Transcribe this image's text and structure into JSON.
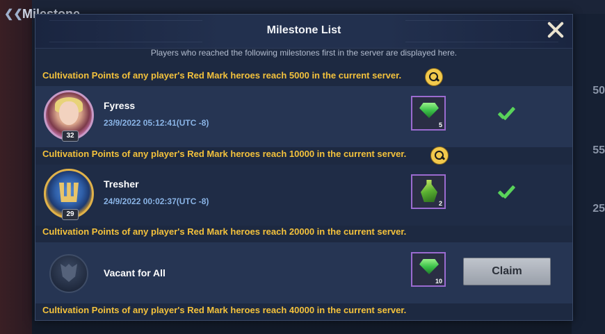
{
  "background": {
    "back_icon": "back-arrow-icon",
    "title": "Milestone",
    "side_numbers": [
      "50",
      "55",
      "25"
    ]
  },
  "modal": {
    "title": "Milestone List",
    "close_icon": "close-icon",
    "subtitle": "Players who reached the following milestones first in the server are displayed here."
  },
  "milestones": [
    {
      "title": "Cultivation Points of any player's Red Mark heroes reach 5000 in the current server.",
      "has_search": true,
      "player": {
        "name": "Fyress",
        "time": "23/9/2022 05:12:41(UTC -8)",
        "level": "32"
      },
      "reward": {
        "icon": "green-gem-icon",
        "qty": "5"
      },
      "status": "completed"
    },
    {
      "title": "Cultivation Points of any player's Red Mark heroes reach 10000 in the current server.",
      "has_search": true,
      "player": {
        "name": "Tresher",
        "time": "24/9/2022 00:02:37(UTC -8)",
        "level": "29"
      },
      "reward": {
        "icon": "green-potion-icon",
        "qty": "2"
      },
      "status": "completed"
    },
    {
      "title": "Cultivation Points of any player's Red Mark heroes reach 20000 in the current server.",
      "has_search": false,
      "player": {
        "name": "Vacant for All"
      },
      "reward": {
        "icon": "green-gem-icon",
        "qty": "10"
      },
      "status": "claim",
      "claim_label": "Claim"
    },
    {
      "title": "Cultivation Points of any player's Red Mark heroes reach 40000 in the current server."
    }
  ],
  "colors": {
    "accent_gold": "#f4c23c",
    "check_green": "#59d35a",
    "time_blue": "#8ab4e6"
  }
}
